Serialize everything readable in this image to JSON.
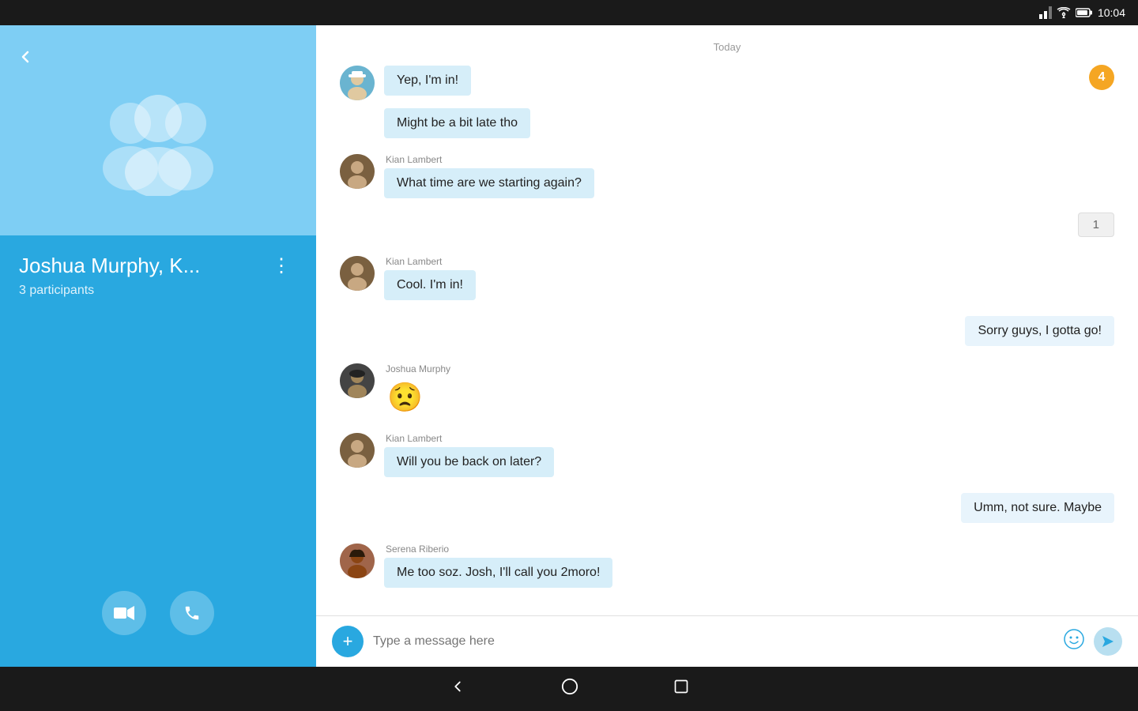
{
  "status_bar": {
    "time": "10:04",
    "signal": "▲",
    "wifi": "▼",
    "battery": "🔋"
  },
  "sidebar": {
    "back_label": "‹",
    "group_name": "Joshua Murphy, K...",
    "participants": "3 participants",
    "more_options": "⋮",
    "video_icon": "📹",
    "call_icon": "📞"
  },
  "chat": {
    "date_label": "Today",
    "notification_count": "4",
    "messages": [
      {
        "id": 1,
        "sender": "self",
        "avatar": null,
        "sender_name": "",
        "text": "Yep, I'm in!",
        "type": "text"
      },
      {
        "id": 2,
        "sender": "self",
        "avatar": null,
        "sender_name": "",
        "text": "Might be a bit late tho",
        "type": "text"
      },
      {
        "id": 3,
        "sender": "kian",
        "avatar": "kian",
        "sender_name": "Kian Lambert",
        "text": "What time are we starting again?",
        "type": "text"
      },
      {
        "id": 4,
        "sender": "self",
        "avatar": null,
        "sender_name": "",
        "text": "1",
        "type": "reaction"
      },
      {
        "id": 5,
        "sender": "kian",
        "avatar": "kian",
        "sender_name": "Kian Lambert",
        "text": "Cool. I'm in!",
        "type": "text"
      },
      {
        "id": 6,
        "sender": "self",
        "avatar": null,
        "sender_name": "",
        "text": "Sorry guys, I gotta go!",
        "type": "text"
      },
      {
        "id": 7,
        "sender": "joshua",
        "avatar": "joshua",
        "sender_name": "Joshua Murphy",
        "text": "😟",
        "type": "emoji"
      },
      {
        "id": 8,
        "sender": "kian",
        "avatar": "kian",
        "sender_name": "Kian Lambert",
        "text": "Will you be back on later?",
        "type": "text"
      },
      {
        "id": 9,
        "sender": "self",
        "avatar": null,
        "sender_name": "",
        "text": "Umm, not sure. Maybe",
        "type": "text"
      },
      {
        "id": 10,
        "sender": "serena",
        "avatar": "serena",
        "sender_name": "Serena Riberio",
        "text": "Me too soz. Josh, I'll call you 2moro!",
        "type": "text"
      }
    ]
  },
  "input": {
    "placeholder": "Type a message here",
    "add_icon": "+",
    "send_icon": "→"
  }
}
